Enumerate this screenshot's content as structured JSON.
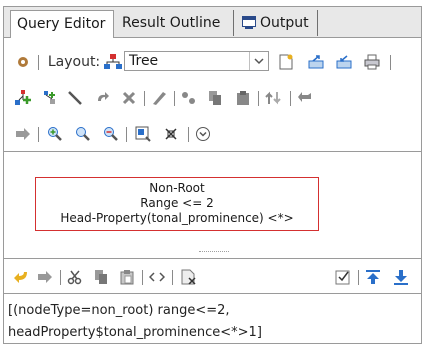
{
  "tabs": [
    {
      "label": "Query Editor",
      "active": true
    },
    {
      "label": "Result Outline",
      "active": false
    },
    {
      "label": "Output",
      "active": false,
      "icon": "output-window-icon"
    }
  ],
  "toolbar": {
    "layout_label": "Layout:",
    "layout_value": "Tree",
    "icons_row1": [
      "settings-icon",
      "layout-tree-icon",
      "new-file-icon",
      "export-icon",
      "import-icon",
      "print-icon"
    ],
    "icons_row2": [
      "add-node-icon",
      "add-sibling-icon",
      "draw-edge-icon",
      "redo-icon",
      "delete-icon",
      "edit-icon",
      "connect-icon",
      "copy-icon",
      "paste-icon",
      "sort-icon",
      "back-icon"
    ],
    "icons_row3": [
      "forward-icon",
      "zoom-in-icon",
      "zoom-normal-icon",
      "zoom-out-icon",
      "fit-icon",
      "fullscreen-icon",
      "expand-icon"
    ]
  },
  "node": {
    "line1": "Non-Root",
    "line2": "Range <= 2",
    "line3": "Head-Property(tonal_prominence) <*>"
  },
  "bottom_toolbar": {
    "icons": [
      "undo-icon",
      "redo-icon",
      "cut-icon",
      "copy-icon",
      "paste-icon",
      "code-icon",
      "format-icon",
      "validate-icon",
      "move-top-icon",
      "download-icon"
    ]
  },
  "query": {
    "line1": "[(nodeType=non_root) range<=2,",
    "line2": "headProperty$tonal_prominence<*>1]"
  },
  "colors": {
    "node_border": "#d43030",
    "accent_blue": "#2a6fc9",
    "icon_green": "#3a9a2a"
  }
}
